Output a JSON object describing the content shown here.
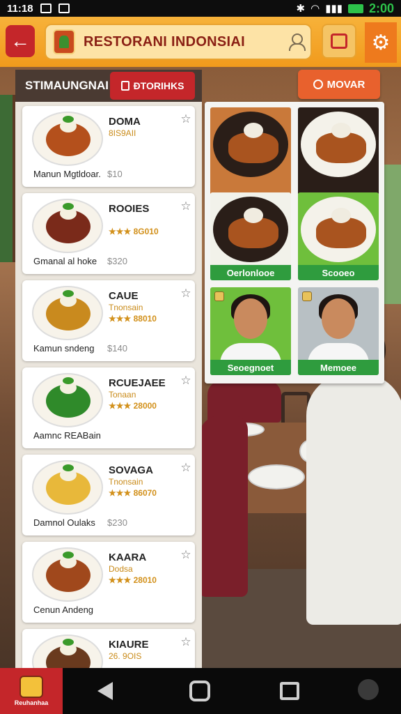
{
  "status_bar": {
    "time": "11:18",
    "clock_right": "2:00"
  },
  "header": {
    "title": "RESTORANI INDONSIAI",
    "back_icon": "arrow-left-icon",
    "chat_icon": "chat-icon",
    "settings_icon": "gear-icon"
  },
  "tabs": {
    "left_label": "STIMAUNGNAI",
    "right_label": "ĐTORIHKS"
  },
  "move_button": {
    "label": "MOVAR"
  },
  "menu": {
    "items": [
      {
        "name": "DOMA",
        "sub": "8IS9AII",
        "rating": "",
        "desc": "Manun Mgtldoar.",
        "price": "$10",
        "food_color": "#b4501c"
      },
      {
        "name": "ROOIES",
        "sub": "",
        "rating": "★★★ 8G010",
        "desc": "Gmanal al hoke",
        "price": "$320",
        "food_color": "#7a2a1a"
      },
      {
        "name": "CAUE",
        "sub": "Tnonsain",
        "rating": "★★★ 88010",
        "desc": "Kamun sndeng",
        "price": "$140",
        "food_color": "#c98a1e"
      },
      {
        "name": "RCUEJAEE",
        "sub": "Tonaan",
        "rating": "★★★ 28000",
        "desc": "Aamnc REABain",
        "price": "",
        "food_color": "#2f8a2a"
      },
      {
        "name": "SOVAGA",
        "sub": "Tnonsain",
        "rating": "★★★ 86070",
        "desc": "Damnol Oulaks",
        "price": "$230",
        "food_color": "#e8b83a"
      },
      {
        "name": "KAARA",
        "sub": "Dodsa",
        "rating": "★★★ 28010",
        "desc": "Cenun Andeng",
        "price": "",
        "food_color": "#a0481c"
      },
      {
        "name": "KIAURE",
        "sub": "26. 9OIS",
        "rating": "",
        "desc": "",
        "price": "",
        "food_color": "#6a3a1e"
      }
    ]
  },
  "gallery": {
    "tiles": [
      {
        "label": "",
        "kind": "food",
        "plate": "dark"
      },
      {
        "label": "",
        "kind": "food",
        "plate": "white"
      },
      {
        "label": "Oerlonlooe",
        "kind": "food",
        "plate": "dark"
      },
      {
        "label": "Scooeo",
        "kind": "food",
        "plate": "white"
      },
      {
        "label": "Seoegnoet",
        "kind": "portrait"
      },
      {
        "label": "Memoee",
        "kind": "portrait"
      }
    ]
  },
  "nav": {
    "logo_text": "Reuhanhaa"
  },
  "colors": {
    "brand_red": "#c4262a",
    "header_orange": "#f19a1c",
    "accent_orange": "#e8612d",
    "label_green": "#2f9c3e"
  }
}
